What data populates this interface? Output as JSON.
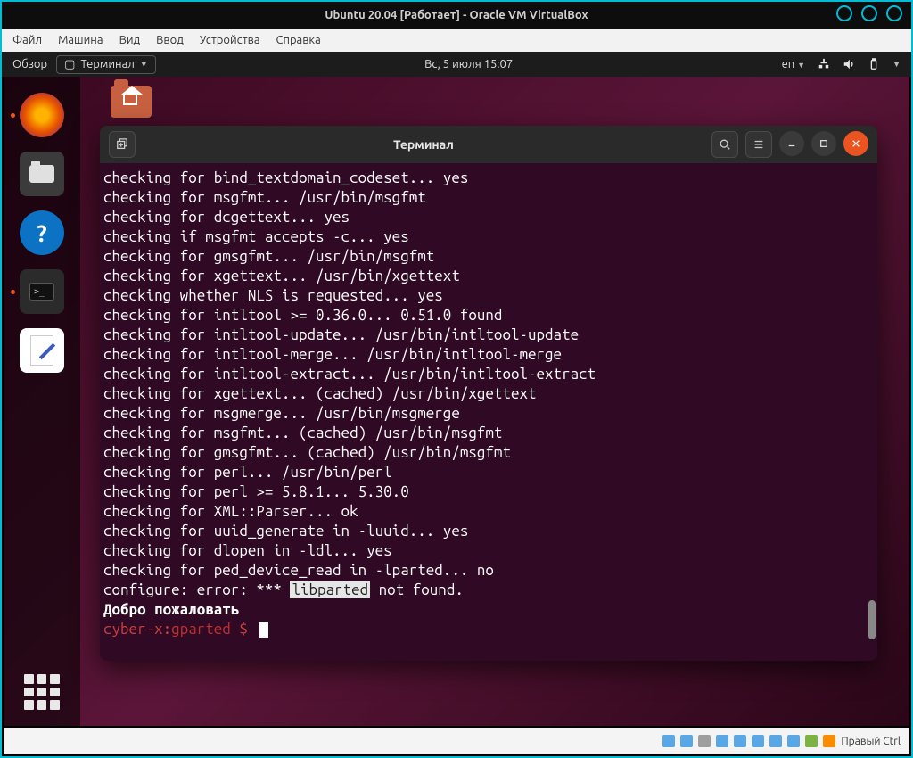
{
  "vb": {
    "title": "Ubuntu 20.04 [Работает] - Oracle VM VirtualBox",
    "menu": [
      "Файл",
      "Машина",
      "Вид",
      "Ввод",
      "Устройства",
      "Справка"
    ],
    "hostkey": "Правый Ctrl"
  },
  "topbar": {
    "activities": "Обзор",
    "app_label": "Терминал",
    "clock": "Вс, 5 июля  15:07",
    "lang": "en"
  },
  "dock": {
    "items": [
      {
        "name": "firefox-icon"
      },
      {
        "name": "files-icon"
      },
      {
        "name": "help-icon"
      },
      {
        "name": "terminal-icon"
      },
      {
        "name": "text-editor-icon"
      }
    ]
  },
  "terminal": {
    "window_title": "Терминал",
    "lines": [
      "checking for bind_textdomain_codeset... yes",
      "checking for msgfmt... /usr/bin/msgfmt",
      "checking for dcgettext... yes",
      "checking if msgfmt accepts -c... yes",
      "checking for gmsgfmt... /usr/bin/msgfmt",
      "checking for xgettext... /usr/bin/xgettext",
      "checking whether NLS is requested... yes",
      "checking for intltool >= 0.36.0... 0.51.0 found",
      "checking for intltool-update... /usr/bin/intltool-update",
      "checking for intltool-merge... /usr/bin/intltool-merge",
      "checking for intltool-extract... /usr/bin/intltool-extract",
      "checking for xgettext... (cached) /usr/bin/xgettext",
      "checking for msgmerge... /usr/bin/msgmerge",
      "checking for msgfmt... (cached) /usr/bin/msgfmt",
      "checking for gmsgfmt... (cached) /usr/bin/msgfmt",
      "checking for perl... /usr/bin/perl",
      "checking for perl >= 5.8.1... 5.30.0",
      "checking for XML::Parser... ok",
      "checking for uuid_generate in -luuid... yes",
      "checking for dlopen in -ldl... yes",
      "checking for ped_device_read in -lparted... no"
    ],
    "error_prefix": "configure: error: *** ",
    "error_highlight": "libparted",
    "error_suffix": " not found.",
    "welcome": "Добро пожаловать",
    "prompt": {
      "user_host": "cyber-x",
      "separator": ":",
      "cwd": "gparted",
      "symbol": " $ "
    }
  }
}
